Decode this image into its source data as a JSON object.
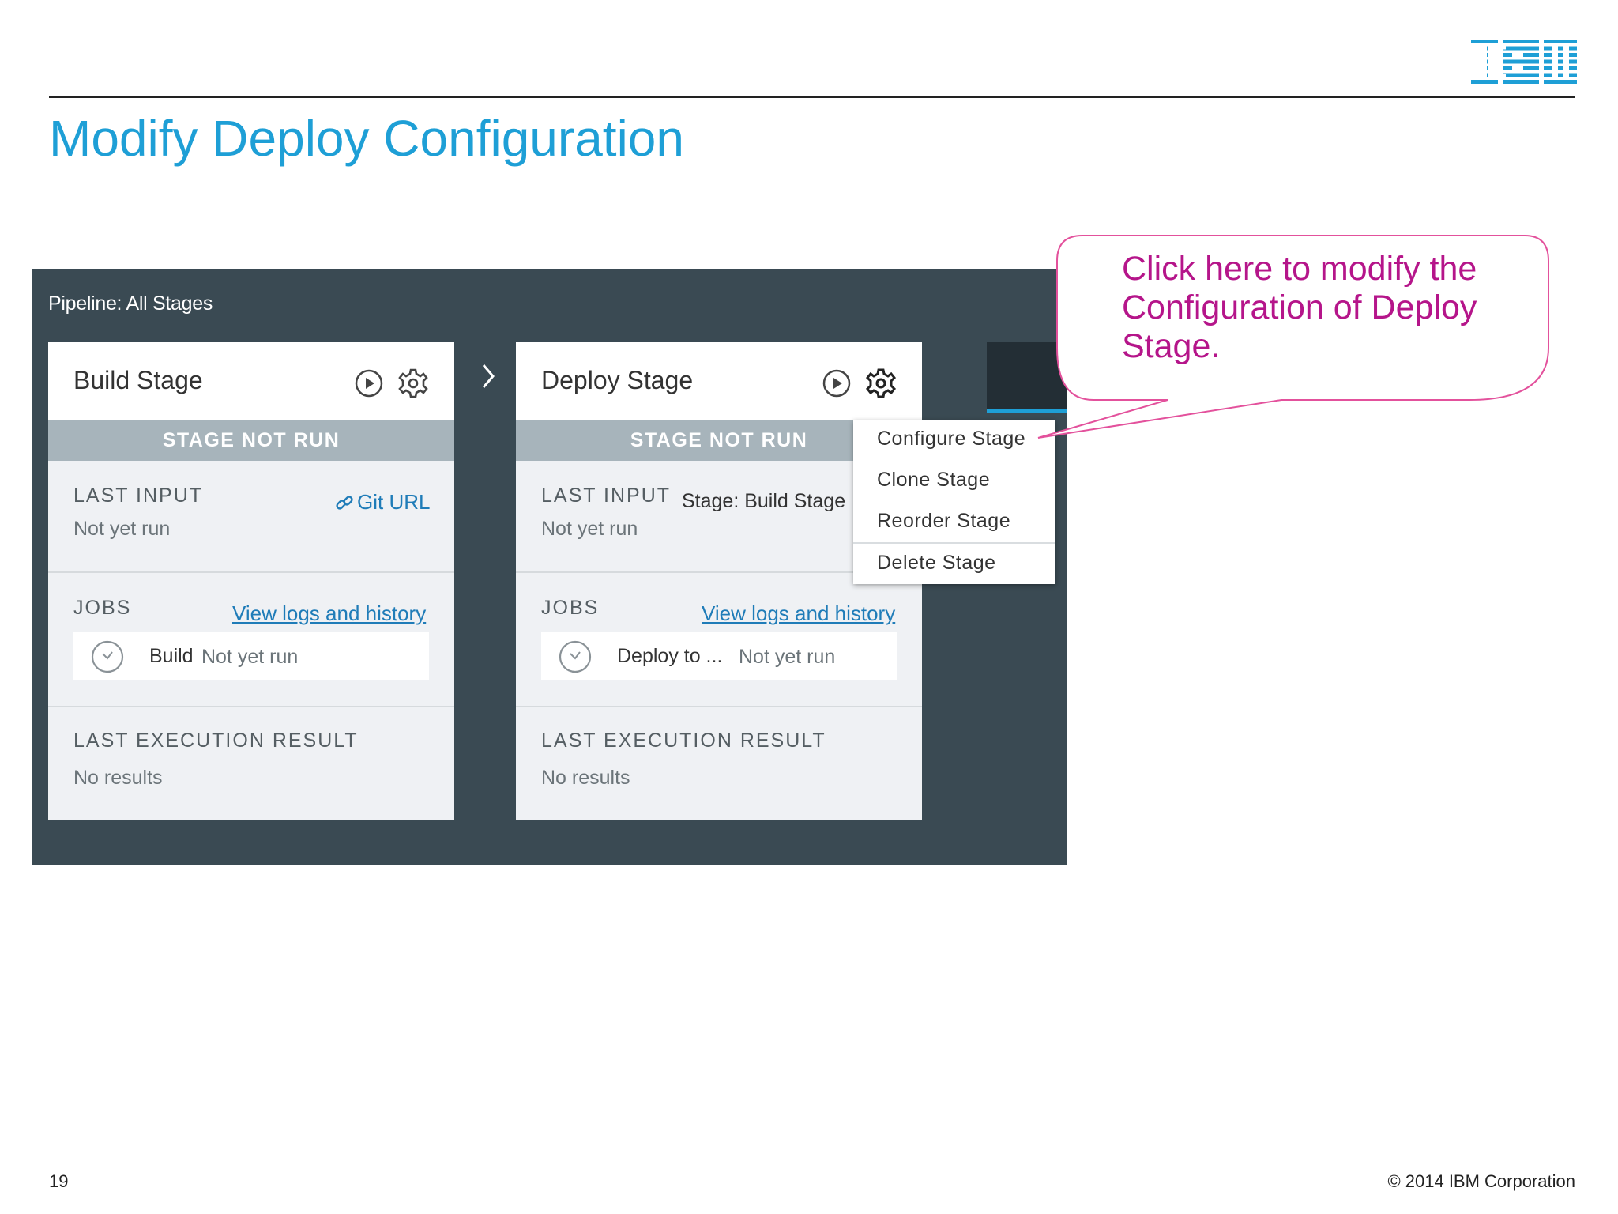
{
  "slide": {
    "title": "Modify Deploy Configuration",
    "page_number": "19",
    "copyright": "© 2014 IBM Corporation",
    "logo": "IBM"
  },
  "pipeline": {
    "title": "Pipeline: All Stages",
    "stages": [
      {
        "name": "Build Stage",
        "status": "STAGE NOT RUN",
        "last_input_label": "LAST INPUT",
        "last_input_link": "Git URL",
        "last_input_value": "Not yet run",
        "jobs_label": "JOBS",
        "jobs_link": "View logs and history",
        "job_name": "Build",
        "job_status": "Not yet run",
        "result_label": "LAST EXECUTION RESULT",
        "result_value": "No results"
      },
      {
        "name": "Deploy Stage",
        "status": "STAGE NOT RUN",
        "last_input_label": "LAST INPUT",
        "last_input_source": "Stage: Build Stage",
        "last_input_value": "Not yet run",
        "jobs_label": "JOBS",
        "jobs_link": "View logs and history",
        "job_name": "Deploy to ...",
        "job_status": "Not yet run",
        "result_label": "LAST EXECUTION RESULT",
        "result_value": "No results"
      }
    ]
  },
  "stage_menu": {
    "items": [
      "Configure Stage",
      "Clone Stage",
      "Reorder Stage",
      "Delete Stage"
    ]
  },
  "callout": {
    "text": "Click here to modify the Configuration of Deploy Stage."
  },
  "colors": {
    "title_blue": "#1e9fd6",
    "panel_bg": "#3a4a53",
    "status_bar": "#a7b4bb",
    "link_blue": "#1f7cb8",
    "callout_magenta": "#b5158a"
  },
  "icons": {
    "play": "play-circle-icon",
    "gear": "gear-icon",
    "link": "link-icon",
    "clock": "clock-icon",
    "chevron": "chevron-right-icon"
  }
}
